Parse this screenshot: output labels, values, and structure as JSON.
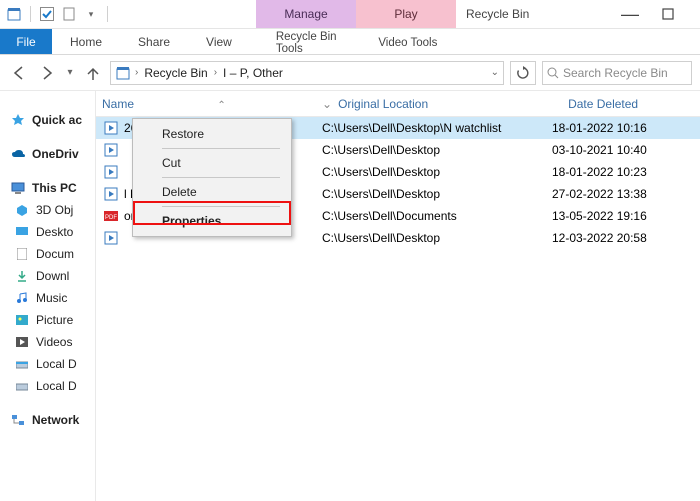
{
  "title": "Recycle Bin",
  "ctx_tabs": {
    "manage": "Manage",
    "play": "Play"
  },
  "ctx_subtabs": {
    "manage": "Recycle Bin Tools",
    "play": "Video Tools"
  },
  "ribbon": {
    "file": "File",
    "home": "Home",
    "share": "Share",
    "view": "View"
  },
  "breadcrumb": {
    "root": "Recycle Bin",
    "sub": "I – P, Other"
  },
  "search_placeholder": "Search Recycle Bin",
  "sidebar": {
    "quick": "Quick ac",
    "onedrive": "OneDriv",
    "thispc": "This PC",
    "items": [
      "3D Obj",
      "Deskto",
      "Docum",
      "Downl",
      "Music",
      "Picture",
      "Videos",
      "Local D",
      "Local D"
    ],
    "network": "Network"
  },
  "columns": {
    "name": "Name",
    "location": "Original Location",
    "date": "Date Deleted"
  },
  "rows": [
    {
      "name": "264",
      "icon": "video",
      "location": "C:\\Users\\Dell\\Desktop\\N watchlist",
      "date": "18-01-2022 10:16",
      "selected": true
    },
    {
      "name": "",
      "icon": "video",
      "location": "C:\\Users\\Dell\\Desktop",
      "date": "03-10-2021 10:40"
    },
    {
      "name": "",
      "icon": "video",
      "location": "C:\\Users\\Dell\\Desktop",
      "date": "18-01-2022 10:23"
    },
    {
      "name": "l H...",
      "icon": "video",
      "location": "C:\\Users\\Dell\\Desktop",
      "date": "27-02-2022 13:38"
    },
    {
      "name": "orm...",
      "icon": "pdf",
      "location": "C:\\Users\\Dell\\Documents",
      "date": "13-05-2022 19:16"
    },
    {
      "name": "",
      "icon": "video",
      "location": "C:\\Users\\Dell\\Desktop",
      "date": "12-03-2022 20:58"
    }
  ],
  "context_menu": {
    "restore": "Restore",
    "cut": "Cut",
    "delete": "Delete",
    "properties": "Properties"
  }
}
